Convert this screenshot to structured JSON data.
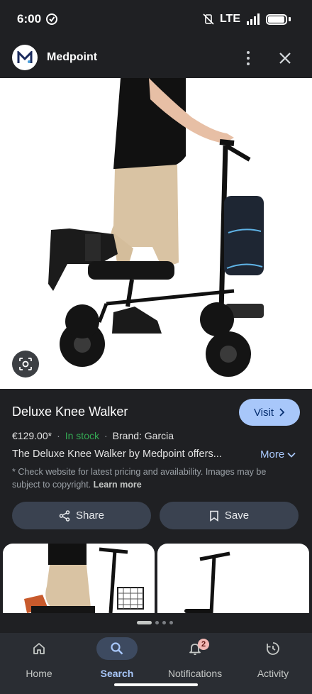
{
  "status_bar": {
    "time": "6:00",
    "network": "LTE"
  },
  "header": {
    "site_name": "Medpoint",
    "logo_letter": "M"
  },
  "product": {
    "title": "Deluxe Knee Walker",
    "price": "€129.00*",
    "stock": "In stock",
    "brand": "Brand: Garcia",
    "description": "The Deluxe Knee Walker by Medpoint offers...",
    "more_label": "More",
    "disclaimer": "* Check website for latest pricing and availability. Images may be subject to copyright.",
    "learn_more": "Learn more"
  },
  "actions": {
    "visit_label": "Visit",
    "share_label": "Share",
    "save_label": "Save"
  },
  "bottom_nav": [
    {
      "label": "Home",
      "icon": "home-icon"
    },
    {
      "label": "Search",
      "icon": "search-icon",
      "active": true
    },
    {
      "label": "Notifications",
      "icon": "bell-icon",
      "badge": "2"
    },
    {
      "label": "Activity",
      "icon": "history-icon"
    }
  ],
  "colors": {
    "accent": "#a8c7fa",
    "in_stock": "#34a853",
    "background": "#1f2023"
  }
}
